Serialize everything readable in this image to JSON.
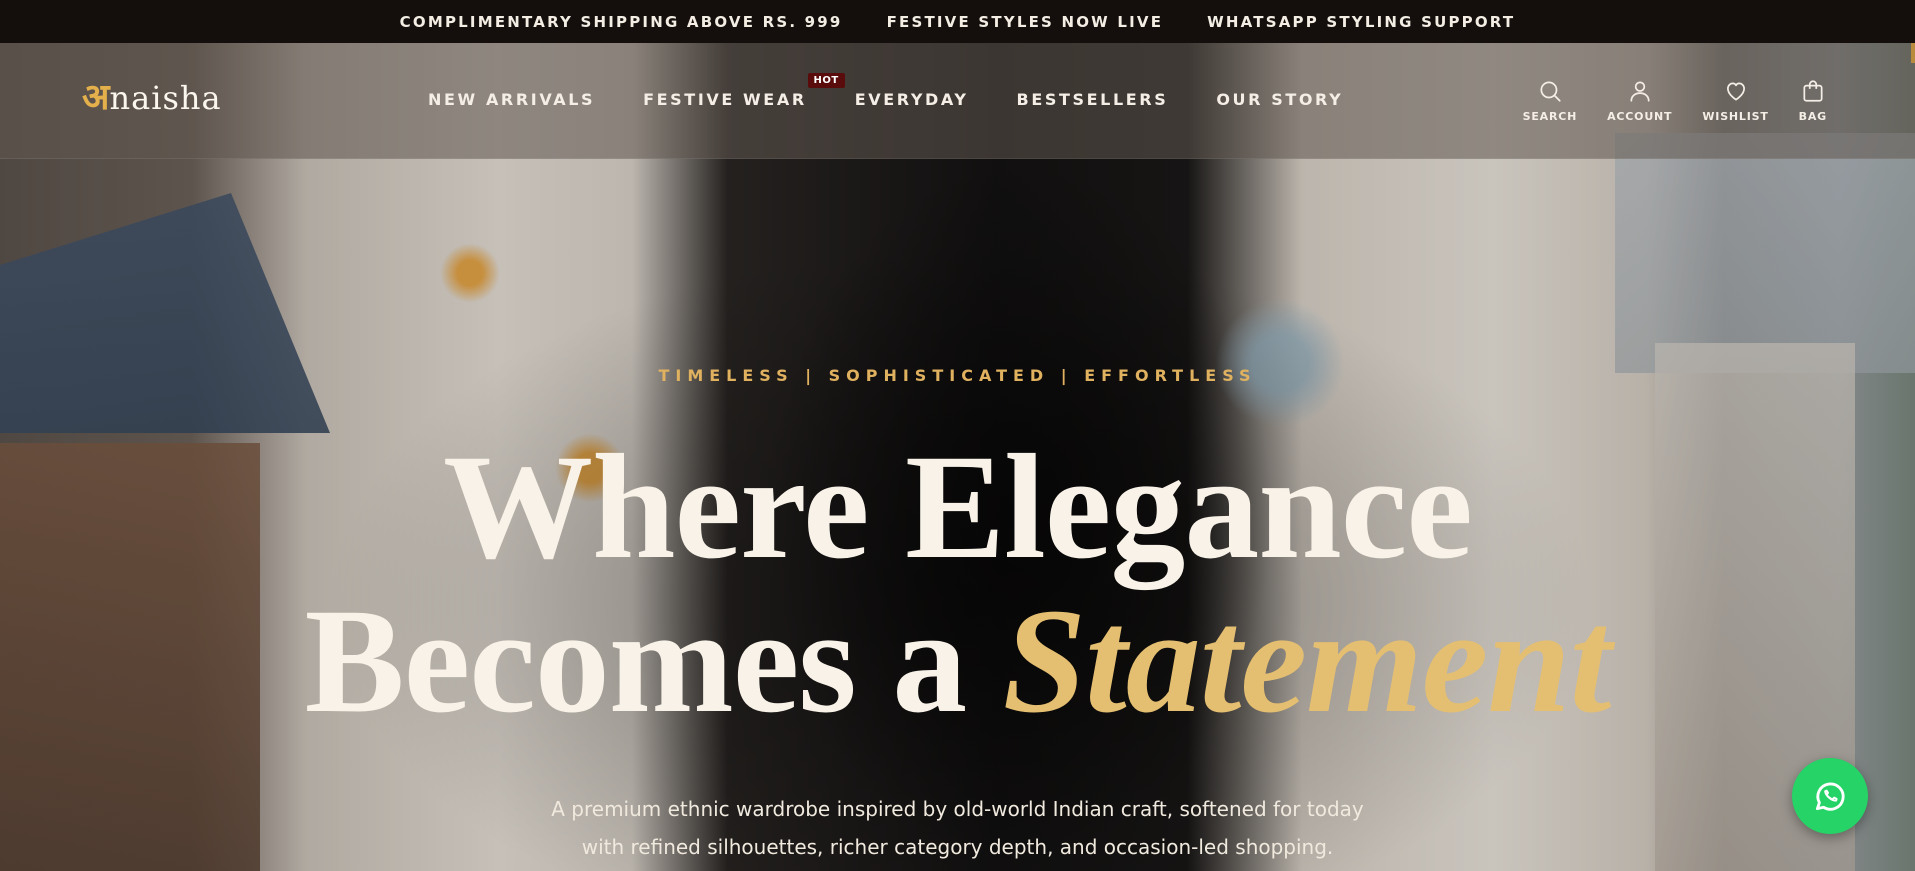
{
  "announcement": {
    "items": [
      "COMPLIMENTARY SHIPPING ABOVE RS. 999",
      "FESTIVE STYLES NOW LIVE",
      "WHATSAPP STYLING SUPPORT"
    ]
  },
  "header": {
    "logo_mark": "अ",
    "logo_text": "naisha",
    "nav": [
      {
        "label": "NEW ARRIVALS"
      },
      {
        "label": "FESTIVE WEAR",
        "badge": "HOT"
      },
      {
        "label": "EVERYDAY"
      },
      {
        "label": "BESTSELLERS"
      },
      {
        "label": "OUR STORY"
      }
    ],
    "actions": [
      {
        "label": "SEARCH",
        "icon": "search-icon"
      },
      {
        "label": "ACCOUNT",
        "icon": "user-icon"
      },
      {
        "label": "WISHLIST",
        "icon": "heart-icon"
      },
      {
        "label": "BAG",
        "icon": "bag-icon"
      }
    ]
  },
  "hero": {
    "tagline": "TIMELESS | SOPHISTICATED | EFFORTLESS",
    "headline_line1": "Where Elegance",
    "headline_line2_prefix": "Becomes a ",
    "headline_accent": "Statement",
    "subcopy_line1": "A premium ethnic wardrobe inspired by old-world Indian craft, softened for today",
    "subcopy_line2": "with refined silhouettes, richer category depth, and occasion-led shopping."
  },
  "colors": {
    "accent_gold": "#e5bf71",
    "announce_bg": "#140f0d",
    "hot_badge": "#5a0c0c",
    "whatsapp": "#25d366"
  },
  "floating": {
    "whatsapp_icon": "whatsapp-icon"
  }
}
